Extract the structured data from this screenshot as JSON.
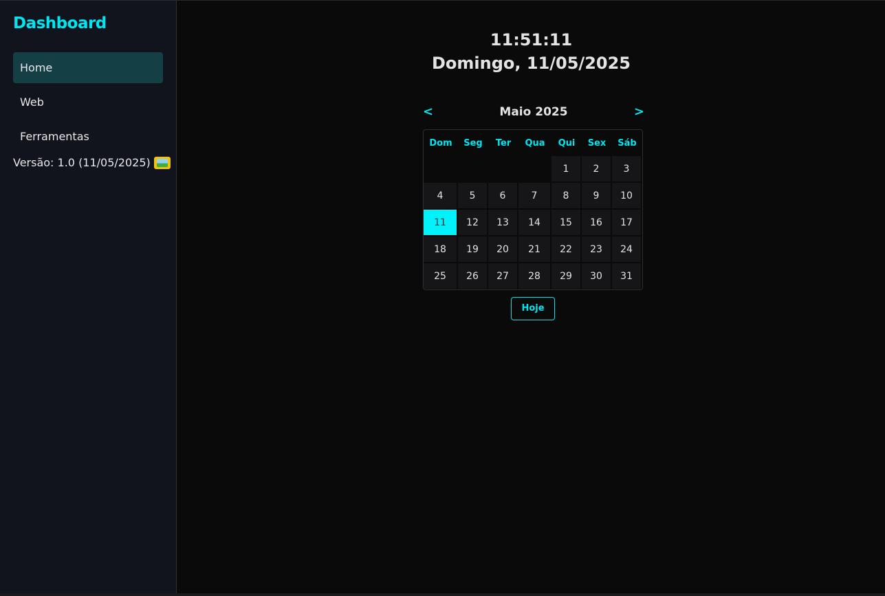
{
  "sidebar": {
    "brand": "Dashboard",
    "items": [
      {
        "label": "Home",
        "active": true
      },
      {
        "label": "Web",
        "active": false
      },
      {
        "label": "Ferramentas",
        "active": false
      }
    ],
    "version": "Versão: 1.0 (11/05/2025)",
    "version_icon": "framed-picture-icon"
  },
  "main": {
    "time": "11:51:11",
    "date": "Domingo, 11/05/2025"
  },
  "calendar": {
    "prev": "<",
    "next": ">",
    "title": "Maio 2025",
    "weekdays": [
      "Dom",
      "Seg",
      "Ter",
      "Qua",
      "Qui",
      "Sex",
      "Sáb"
    ],
    "days": [
      "",
      "",
      "",
      "",
      "1",
      "2",
      "3",
      "4",
      "5",
      "6",
      "7",
      "8",
      "9",
      "10",
      "11",
      "12",
      "13",
      "14",
      "15",
      "16",
      "17",
      "18",
      "19",
      "20",
      "21",
      "22",
      "23",
      "24",
      "25",
      "26",
      "27",
      "28",
      "29",
      "30",
      "31"
    ],
    "selected_day": "11",
    "today_button": "Hoje"
  },
  "colors": {
    "accent": "#00e5f0",
    "sidebar_bg": "#12141d",
    "active_item_bg": "#143f45",
    "main_bg": "#0a0a0b"
  }
}
